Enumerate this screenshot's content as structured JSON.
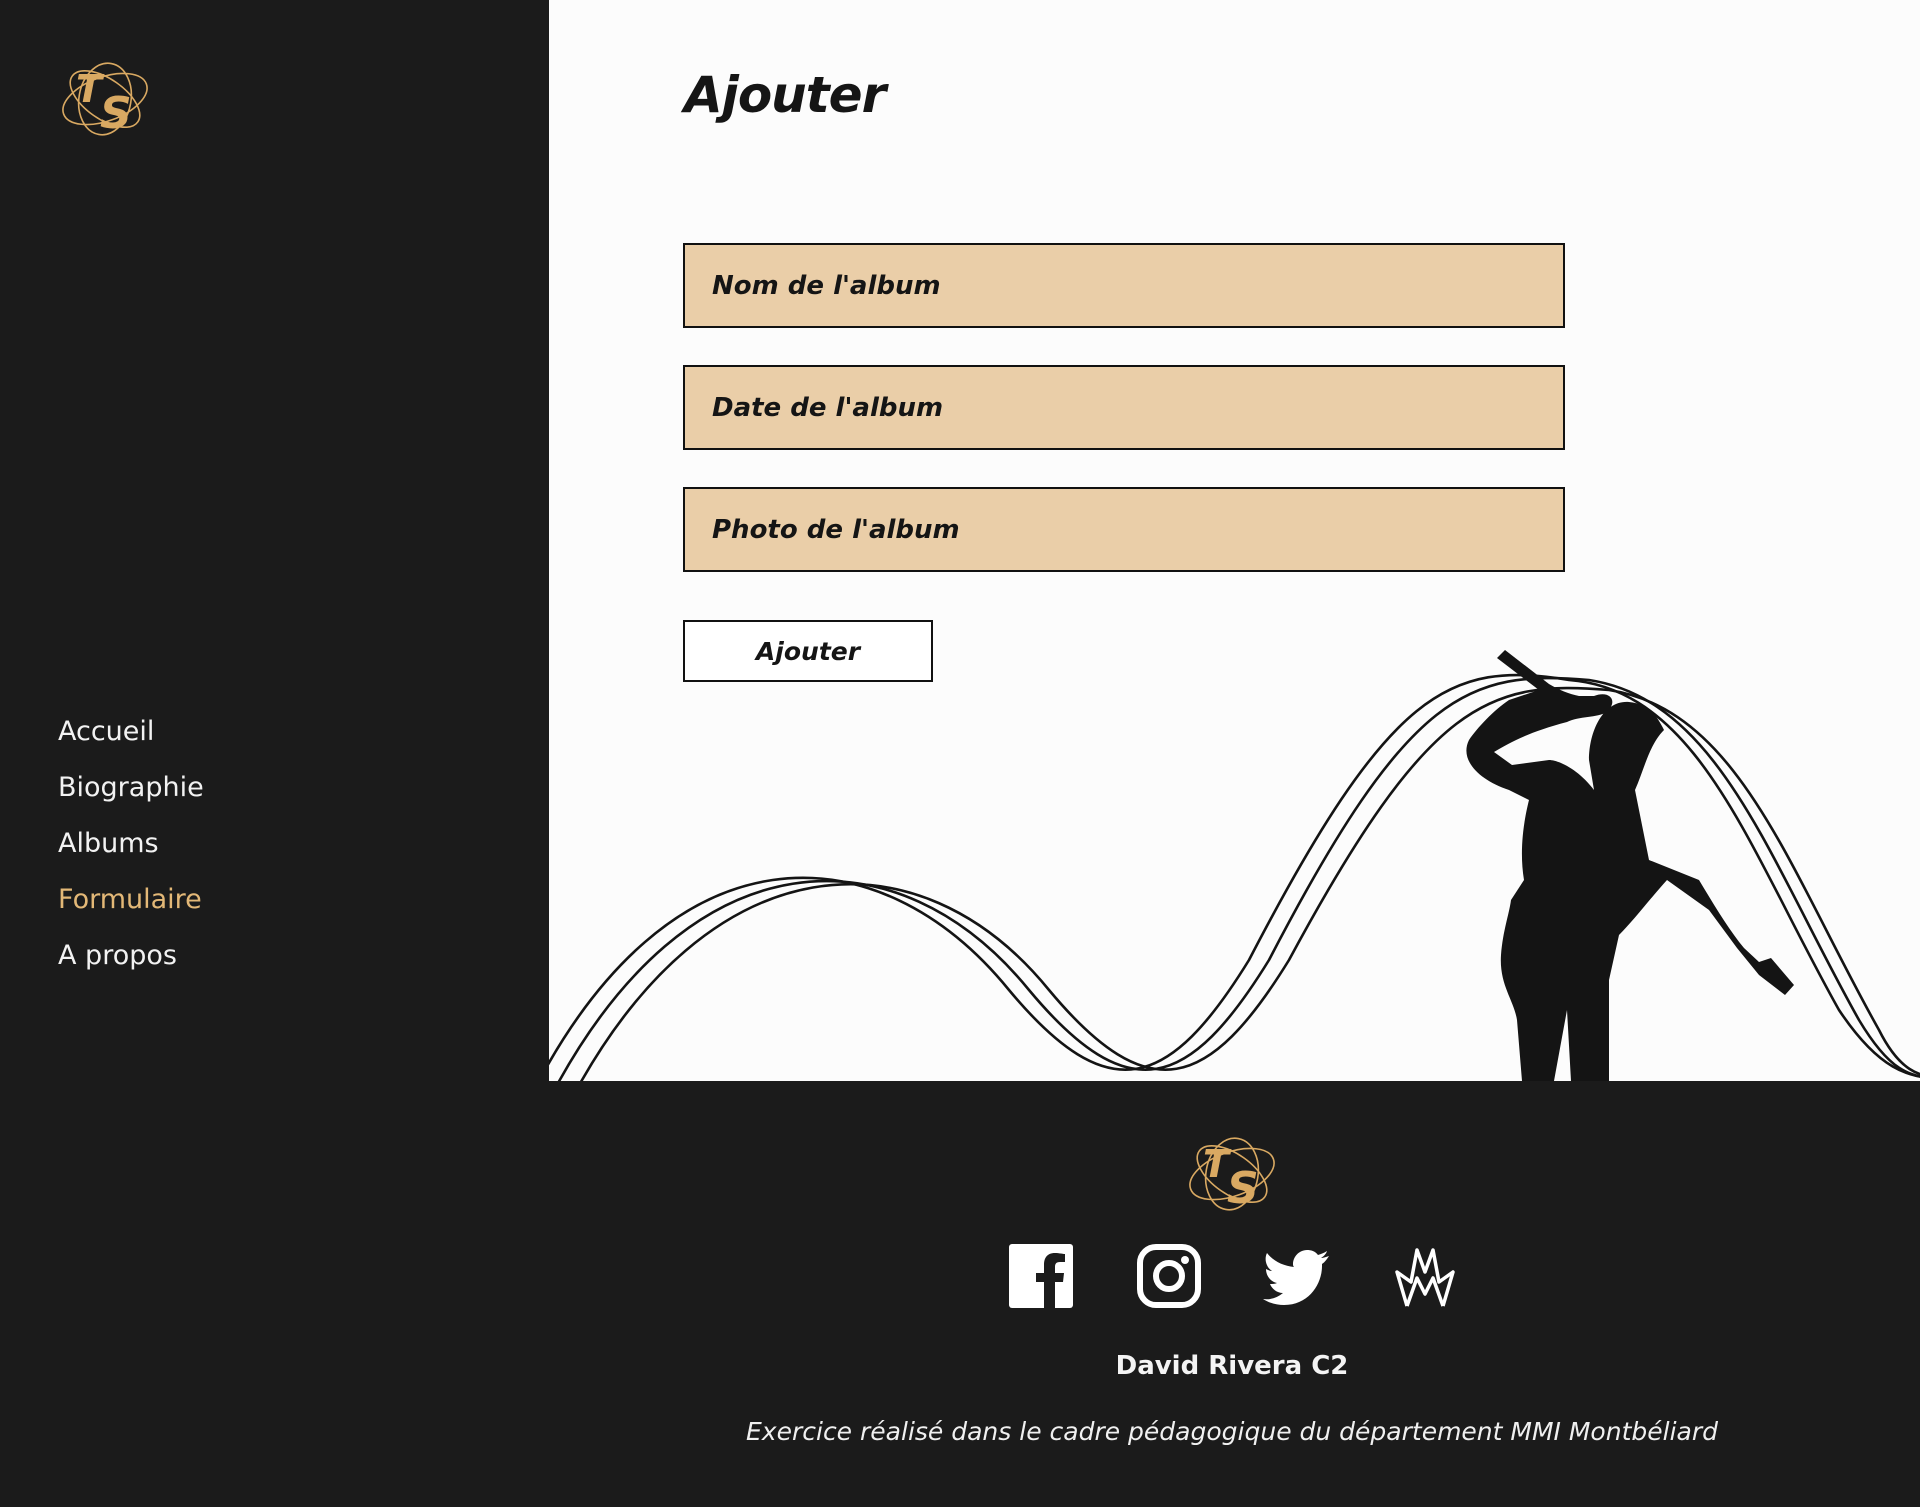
{
  "brand": {
    "logo_text": "TS",
    "accent_color": "#e3b877",
    "logo_color": "#d9a962"
  },
  "sidebar": {
    "items": [
      {
        "label": "Accueil",
        "active": false
      },
      {
        "label": "Biographie",
        "active": false
      },
      {
        "label": "Albums",
        "active": false
      },
      {
        "label": "Formulaire",
        "active": true
      },
      {
        "label": "A propos",
        "active": false
      }
    ]
  },
  "main": {
    "title": "Ajouter",
    "form": {
      "fields": [
        {
          "placeholder": "Nom de l'album",
          "value": ""
        },
        {
          "placeholder": "Date de l'album",
          "value": ""
        },
        {
          "placeholder": "Photo de l'album",
          "value": ""
        }
      ],
      "submit_label": "Ajouter",
      "field_color": "#eacea8"
    }
  },
  "footer": {
    "socials": [
      "facebook-icon",
      "instagram-icon",
      "twitter-icon",
      "crown-logo-icon"
    ],
    "author": "David Rivera C2",
    "credits": "Exercice réalisé dans le cadre pédagogique du département MMI Montbéliard"
  }
}
